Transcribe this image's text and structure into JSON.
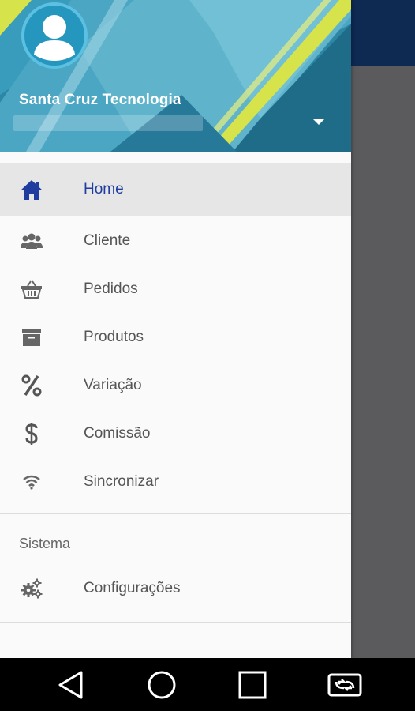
{
  "drawer": {
    "account_name": "Santa Cruz Tecnologia",
    "account_email": "",
    "icon": "account-dropdown-icon"
  },
  "menu": {
    "items": [
      {
        "label": "Home",
        "icon": "home-icon",
        "active": true
      },
      {
        "label": "Cliente",
        "icon": "people-icon"
      },
      {
        "label": "Pedidos",
        "icon": "basket-icon"
      },
      {
        "label": "Produtos",
        "icon": "archive-box-icon"
      },
      {
        "label": "Variação",
        "icon": "percent-icon"
      },
      {
        "label": "Comissão",
        "icon": "dollar-icon"
      },
      {
        "label": "Sincronizar",
        "icon": "wifi-icon"
      }
    ],
    "section_title": "Sistema",
    "system_items": [
      {
        "label": "Configurações",
        "icon": "gears-icon"
      }
    ]
  },
  "navbar": {
    "buttons": [
      "back-icon",
      "home-circle-icon",
      "recents-square-icon",
      "screen-rotate-icon"
    ]
  },
  "colors": {
    "accent": "#1f3c9e",
    "header_bg": "#2f8aa8",
    "appbar": "#0e2a52",
    "stripe_yellow": "#d7e34a"
  }
}
